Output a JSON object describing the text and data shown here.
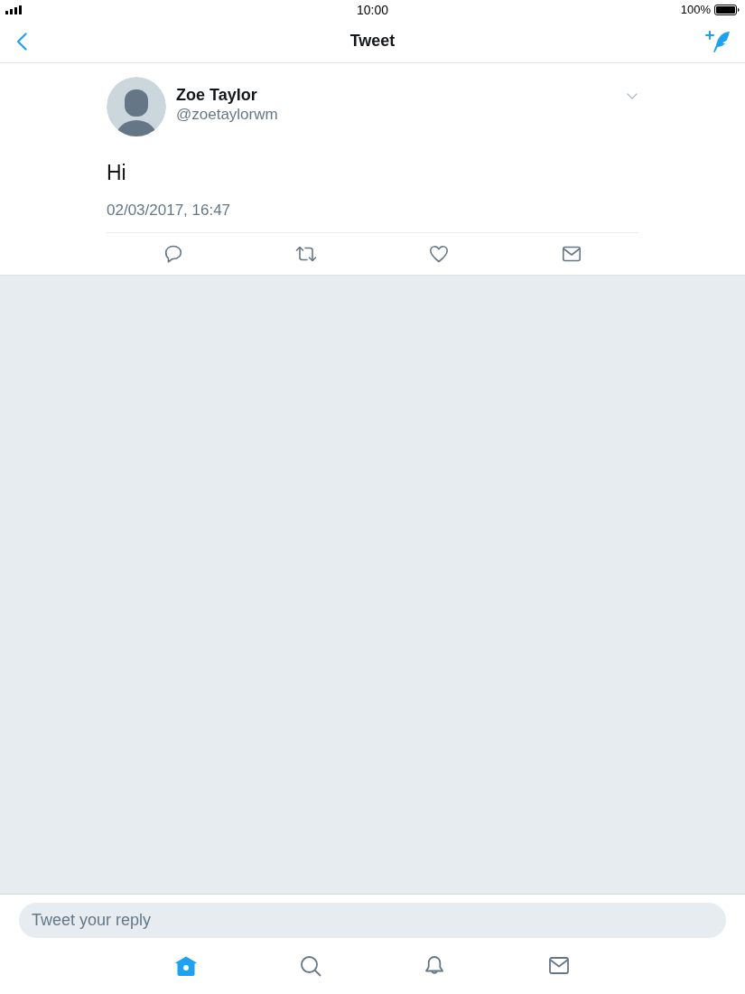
{
  "status_bar": {
    "time": "10:00",
    "battery": "100%"
  },
  "nav_bar": {
    "title": "Tweet"
  },
  "tweet": {
    "name": "Zoe Taylor",
    "handle": "@zoetaylorwm",
    "text": "Hi",
    "timestamp": "02/03/2017, 16:47",
    "actions": [
      {
        "kind": "reply"
      },
      {
        "kind": "retweet"
      },
      {
        "kind": "like"
      },
      {
        "kind": "message"
      }
    ]
  },
  "reply_field": {
    "placeholder": "Tweet your reply"
  },
  "tab_bar": [
    {
      "kind": "home",
      "selected": true
    },
    {
      "kind": "search",
      "selected": false
    },
    {
      "kind": "notifications",
      "selected": false
    },
    {
      "kind": "messages",
      "selected": false
    }
  ]
}
